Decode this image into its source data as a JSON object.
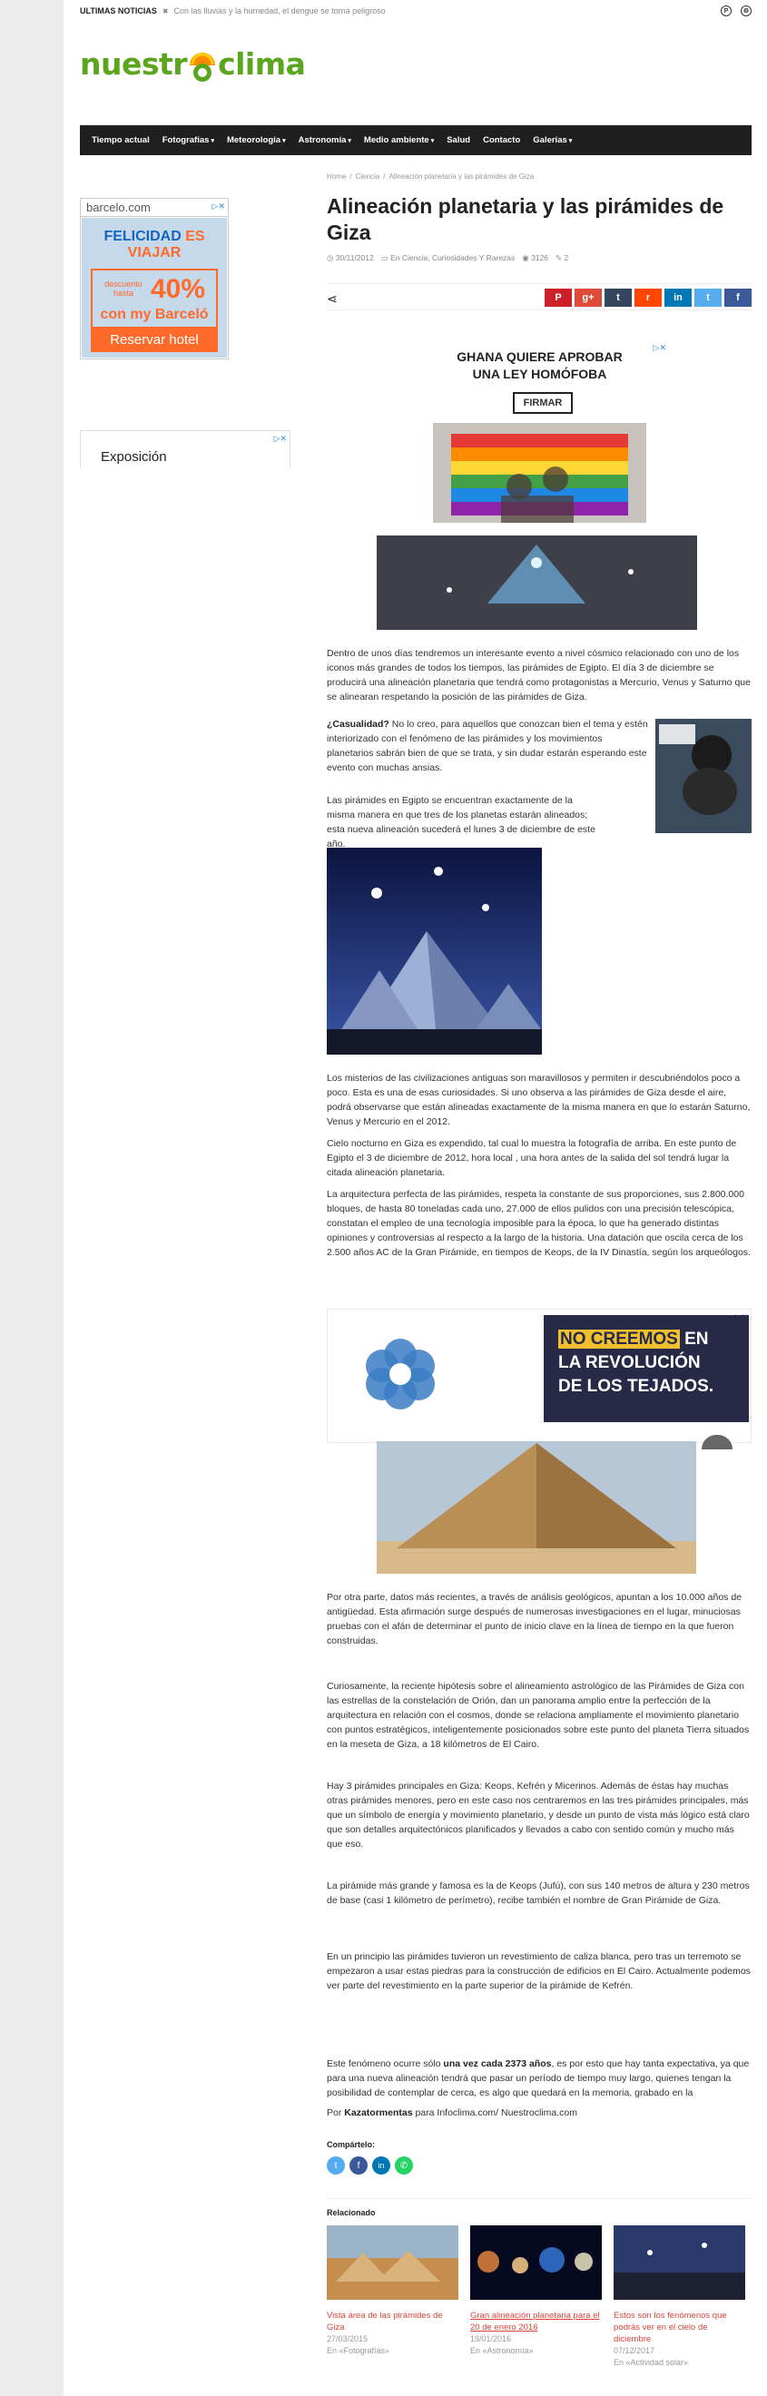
{
  "topbar": {
    "ticker_title": "ULTIMAS NOTICIAS",
    "ticker_text": "Con las lluvias y la humedad, el dengue se torna peligroso"
  },
  "logo": {
    "text_left": "nuestr",
    "text_right": "clima"
  },
  "nav": {
    "items": [
      "Tiempo actual",
      "Fotografías",
      "Meteorología",
      "Astronomía",
      "Medio ambiente",
      "Salud",
      "Contacto",
      "Galerías"
    ]
  },
  "sidebar": {
    "ad1": {
      "brand": "barcelo.com",
      "headline_a": "FELICIDAD",
      "headline_b": " ES VIAJAR",
      "discount_label": "descuento hasta",
      "discount": "40%",
      "with": "con my Barceló",
      "cta": "Reservar hotel"
    },
    "ad2": {
      "text": "Exposición"
    }
  },
  "article": {
    "breadcrumb": [
      "Home",
      "Ciencia",
      "Alineación planetaria y las pirámides de Giza"
    ],
    "title": "Alineación planetaria y las pirámides de Giza",
    "meta": {
      "date": "30/11/2012",
      "categories": "En Ciencia, Curiosidades Y Rarezas",
      "views": "3126",
      "comments": "2"
    },
    "ad3": {
      "line1": "GHANA QUIERE APROBAR",
      "line2": "UNA LEY HOMÓFOBA",
      "button": "FIRMAR"
    },
    "p1": "Dentro de unos días tendremos un interesante evento a nivel cósmico relacionado con uno de los iconos más grandes de todos los tiempos, las pirámides de Egipto. El día 3 de diciembre se producirá una alineación planetaria que tendrá como protagonistas a Mercurio, Venus y Saturno que se alinearan respetando la posición de las pirámides de Giza.",
    "p2_bold": "¿Casualidad?",
    "p2": " No lo creo, para aquellos que conozcan bien el tema y estén interiorizado con el fenómeno de las pirámides y los movimientos planetarios sabrán bien de que se trata, y sin dudar estarán esperando este evento con muchas ansias.",
    "p3": "Las pirámides en Egipto se encuentran exactamente de la misma manera en que tres de los planetas  estarán alineados; esta nueva alineación sucederá el lunes 3 de diciembre de este año.",
    "p4": "Los misterios de las civilizaciones antiguas son maravillosos y permiten ir descubriéndolos poco a poco. Esta es una de esas curiosidades. Si uno observa a las pirámides de Giza desde el aire, podrá observarse que están alineadas exactamente de la misma manera en que lo estarán Saturno, Venus y Mercurio en el 2012.",
    "p5": "Cielo nocturno en Giza es expendido, tal cual lo muestra la fotografía de arriba. En este punto de Egipto el 3 de diciembre de 2012, hora local , una hora antes de la salida del sol tendrá lugar la citada alineación planetaria.",
    "p6": "La  arquitectura perfecta de las pirámides, respeta la  constante de sus proporciones, sus 2.800.000 bloques, de hasta 80 toneladas cada uno, 27.000 de ellos pulidos con una precisión telescópica, constatan el empleo de una tecnología imposible para la época, lo que ha generado distintas opiniones y controversias al respecto a la largo de la historia. Una datación que oscila cerca de los 2.500 años AC de la Gran Pirámide, en tiempos de Keops, de la IV Dinastía, según los arqueólogos.",
    "ad4": {
      "text_a": "NO CREEMOS",
      "text_b": " EN",
      "line2": "LA REVOLUCIÓN",
      "line3": "DE LOS TEJADOS."
    },
    "p7": "Por otra parte, datos más recientes, a través de análisis geológicos, apuntan a los 10.000 años de antigüedad. Esta afirmación surge después de numerosas investigaciones en el lugar, minuciosas pruebas con el afán de determinar el punto de inicio clave en la línea de tiempo en la que fueron construidas.",
    "p8": "Curiosamente, la reciente hipótesis sobre el alineamiento astrológico de las Pirámides de Giza con las estrellas de la constelación de Orión, dan un panorama amplio entre la perfección de la arquitectura en relación con el cosmos, donde se relaciona ampliamente el movimiento planetario con puntos estratégicos, inteligentemente posicionados sobre este punto del planeta Tierra situados en la meseta de Giza, a 18 kilómetros de El Cairo.",
    "p9": "Hay 3 pirámides principales en Giza: Keops, Kefrén y Micerinos. Además de éstas hay muchas otras pirámides menores, pero en este caso nos centraremos en las tres pirámides principales, más que un símbolo de energía y movimiento planetario, y desde un punto de vista más lógico está claro que son detalles arquitectónicos planificados y llevados a cabo con sentido común y mucho más que eso.",
    "p10": "La pirámide más grande y famosa es la de Keops (Jufú), con sus 140 metros de altura y 230 metros de base (casi 1 kilómetro de perímetro), recibe también el nombre de Gran Pirámide de Giza.",
    "p11": "En un principio las pirámides tuvieron un revestimiento de caliza blanca, pero tras un terremoto se empezaron a usar estas piedras para la construcción de edificios en El Cairo. Actualmente podemos ver parte del revestimiento en la parte superior de la pirámide de Kefrén.",
    "p12_a": "Este fenómeno ocurre sólo ",
    "p12_bold": "una vez cada 2373 años",
    "p12_b": ", es por esto que hay tanta expectativa, ya que para una nueva alineación tendrá que pasar un período de tiempo muy largo, quienes tengan la posibilidad de contemplar de cerca, es algo que quedará en la memoria, grabado en la",
    "byline_pre": "Por ",
    "byline_bold": "Kazatormentas",
    "byline_post": " para Infoclima.com/ Nuestroclima.com",
    "share_label": "Compártelo:",
    "related_label": "Relacionado",
    "related": [
      {
        "title": "Vista área de las pirámides de Giza",
        "date": "27/03/2015",
        "cat": "En «Fotografías»"
      },
      {
        "title": "Gran alineación planetaria para el 20 de enero 2016",
        "date": "19/01/2016",
        "cat": "En «Astronomía»"
      },
      {
        "title": "Estos son los fenómenos que podrás ver en el cielo de diciembre",
        "date": "07/12/2017",
        "cat": "En «Actividad solar»"
      }
    ]
  },
  "colors": {
    "brand_green": "#5aa61f",
    "nav_bg": "#1f1f1f",
    "link_red": "#d9453a"
  }
}
